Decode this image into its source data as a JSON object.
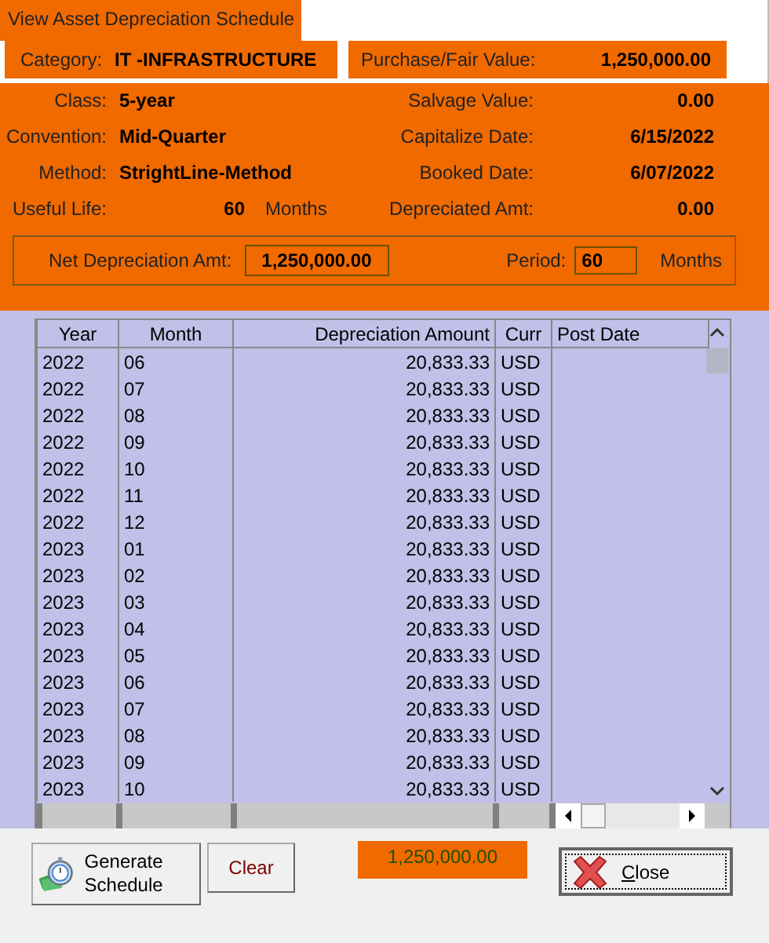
{
  "window": {
    "title": "View Asset Depreciation Schedule"
  },
  "header": [
    {
      "label": "Category:",
      "value": "IT -INFRASTRUCTURE"
    },
    {
      "label": "Purchase/Fair Value:",
      "value": "1,250,000.00"
    }
  ],
  "details": [
    {
      "left": {
        "label": "Class:",
        "value": "5-year"
      },
      "right": {
        "label": "Salvage Value:",
        "value": "0.00"
      }
    },
    {
      "left": {
        "label": "Convention:",
        "value": "Mid-Quarter"
      },
      "right": {
        "label": "Capitalize Date:",
        "value": "6/15/2022"
      }
    },
    {
      "left": {
        "label": "Method:",
        "value": "StrightLine-Method"
      },
      "right": {
        "label": "Booked Date:",
        "value": "6/07/2022"
      }
    },
    {
      "left": {
        "label": "Useful Life:",
        "value": "60",
        "unit": "Months"
      },
      "right": {
        "label": "Depreciated Amt:",
        "value": "0.00"
      }
    }
  ],
  "net": {
    "label": "Net Depreciation Amt:",
    "value": "1,250,000.00"
  },
  "period": {
    "label": "Period:",
    "value": "60",
    "unit": "Months"
  },
  "table": {
    "columns": [
      "Year",
      "Month",
      "Depreciation Amount",
      "Curr",
      "Post Date"
    ],
    "rows": [
      [
        "2022",
        "06",
        "20,833.33",
        "USD"
      ],
      [
        "2022",
        "07",
        "20,833.33",
        "USD"
      ],
      [
        "2022",
        "08",
        "20,833.33",
        "USD"
      ],
      [
        "2022",
        "09",
        "20,833.33",
        "USD"
      ],
      [
        "2022",
        "10",
        "20,833.33",
        "USD"
      ],
      [
        "2022",
        "11",
        "20,833.33",
        "USD"
      ],
      [
        "2022",
        "12",
        "20,833.33",
        "USD"
      ],
      [
        "2023",
        "01",
        "20,833.33",
        "USD"
      ],
      [
        "2023",
        "02",
        "20,833.33",
        "USD"
      ],
      [
        "2023",
        "03",
        "20,833.33",
        "USD"
      ],
      [
        "2023",
        "04",
        "20,833.33",
        "USD"
      ],
      [
        "2023",
        "05",
        "20,833.33",
        "USD"
      ],
      [
        "2023",
        "06",
        "20,833.33",
        "USD"
      ],
      [
        "2023",
        "07",
        "20,833.33",
        "USD"
      ],
      [
        "2023",
        "08",
        "20,833.33",
        "USD"
      ],
      [
        "2023",
        "09",
        "20,833.33",
        "USD"
      ],
      [
        "2023",
        "10",
        "20,833.33",
        "USD"
      ]
    ]
  },
  "footer": {
    "buttons": [
      {
        "kind": "generate",
        "label": "Generate Schedule"
      },
      {
        "kind": "plain",
        "label": "Clear"
      }
    ],
    "total": "1,250,000.00",
    "close": "Close"
  }
}
